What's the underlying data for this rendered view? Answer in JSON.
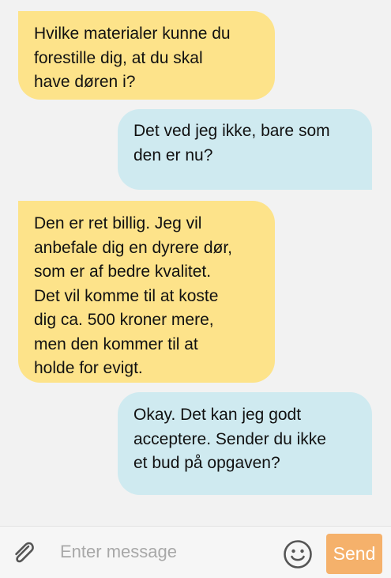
{
  "messages": [
    {
      "direction": "incoming",
      "text": "Hvilke materialer kunne du\nforestille dig, at du skal\nhave døren i?"
    },
    {
      "direction": "outgoing",
      "text": "Det ved jeg ikke, bare som\nden er nu?"
    },
    {
      "direction": "incoming",
      "text": "Den er ret billig. Jeg vil\nanbefale dig en dyrere dør,\nsom er af bedre kvalitet.\nDet vil komme til at koste\ndig ca. 500 kroner mere,\nmen den kommer til at\nholde for evigt."
    },
    {
      "direction": "outgoing",
      "text": "Okay. Det kan jeg godt\nacceptere. Sender du ikke\net bud på opgaven?"
    }
  ],
  "composer": {
    "placeholder": "Enter message",
    "value": "",
    "send_label": "Send",
    "attach_icon": "paperclip-icon",
    "emoji_icon": "smiley-icon"
  },
  "colors": {
    "incoming_bubble": "#fde38a",
    "outgoing_bubble": "#cfeaf0",
    "send_button": "#f5b16b",
    "background": "#f2f2f2"
  }
}
